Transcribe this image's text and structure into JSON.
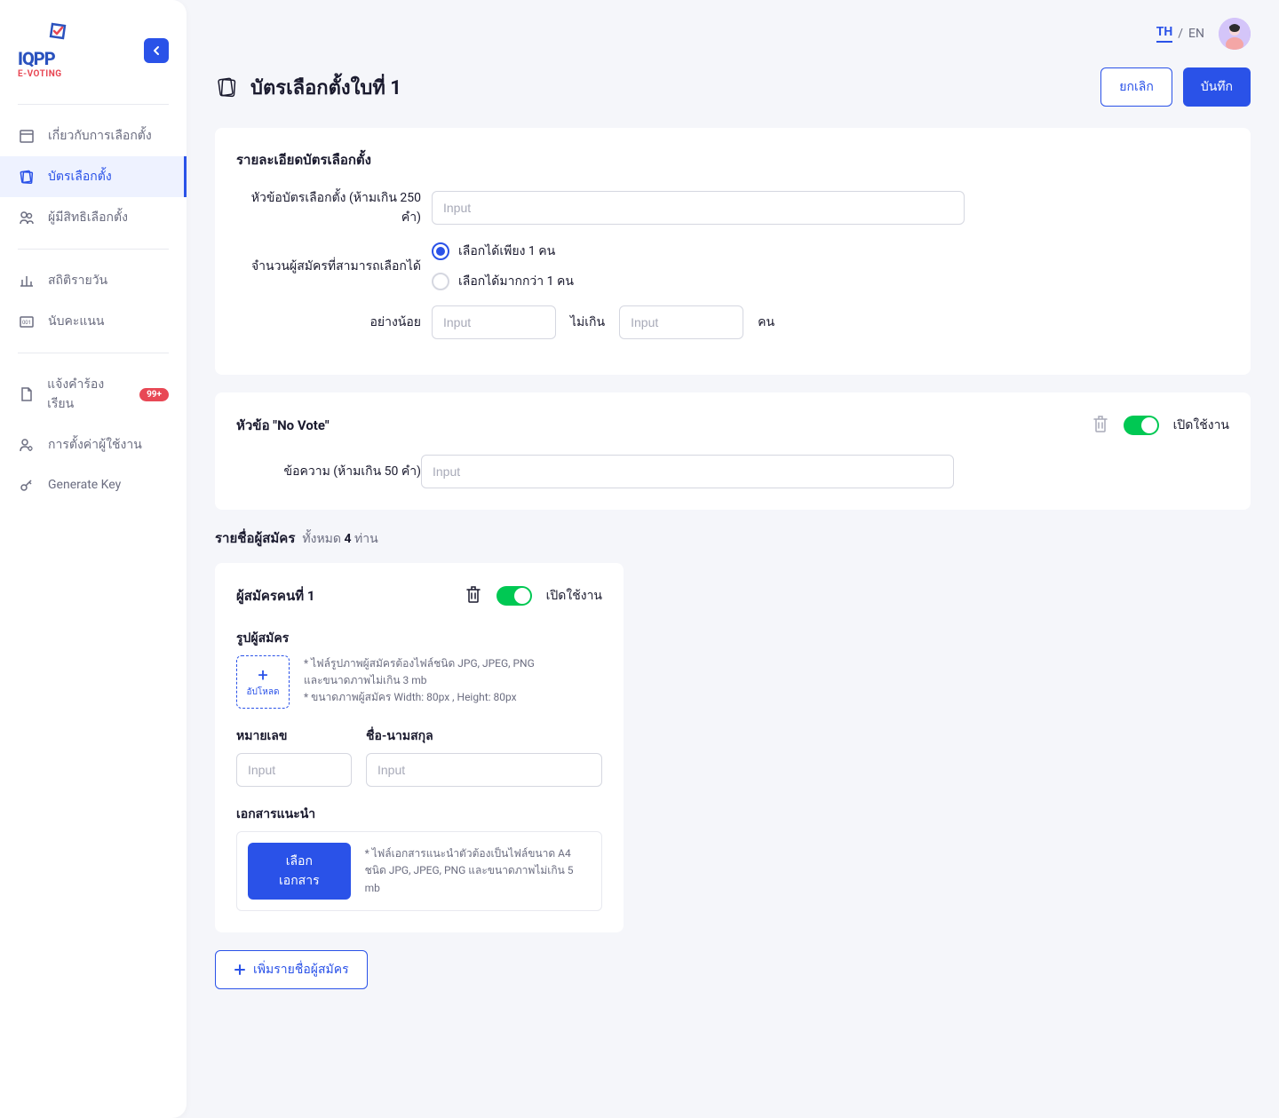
{
  "lang": {
    "th": "TH",
    "en": "EN",
    "sep": "/"
  },
  "logo": {
    "top": "IQPP",
    "sub": "E-VOTING"
  },
  "nav": {
    "about": "เกี่ยวกับการเลือกตั้ง",
    "ballot": "บัตรเลือกตั้ง",
    "voters": "ผู้มีสิทธิเลือกตั้ง",
    "daily": "สถิติรายวัน",
    "count": "นับคะแนน",
    "complaint": "แจ้งคำร้องเรียน",
    "complaint_badge": "99+",
    "settings": "การตั้งค่าผู้ใช้งาน",
    "genkey": "Generate Key"
  },
  "page": {
    "title": "บัตรเลือกตั้งใบที่ 1",
    "cancel": "ยกเลิก",
    "save": "บันทึก"
  },
  "details": {
    "section": "รายละเอียดบัตรเลือกตั้ง",
    "title_label": "หัวข้อบัตรเลือกตั้ง (ห้ามเกิน 250 คำ)",
    "title_placeholder": "Input",
    "count_label": "จำนวนผู้สมัครที่สามารถเลือกได้",
    "radio_one": "เลือกได้เพียง 1 คน",
    "radio_many": "เลือกได้มากกว่า 1 คน",
    "at_least": "อย่างน้อย",
    "at_most": "ไม่เกิน",
    "unit": "คน",
    "min_placeholder": "Input",
    "max_placeholder": "Input"
  },
  "novote": {
    "section": "หัวข้อ \"No Vote\"",
    "enable": "เปิดใช้งาน",
    "msg_label": "ข้อความ (ห้ามเกิน 50 คำ)",
    "msg_placeholder": "Input"
  },
  "candidates": {
    "section": "รายชื่อผู้สมัคร",
    "total_label": "ทั้งหมด",
    "total_count": "4",
    "total_unit": "ท่าน",
    "item_title": "ผู้สมัครคนที่ 1",
    "enable": "เปิดใช้งาน",
    "photo_label": "รูปผู้สมัคร",
    "upload": "อัปโหลด",
    "hint1": "* ไฟล์รูปภาพผู้สมัครต้องไฟล์ชนิด JPG, JPEG, PNG",
    "hint2": "และขนาดภาพไม่เกิน 3 mb",
    "hint3": "* ขนาดภาพผู้สมัคร Width: 80px , Height: 80px",
    "number_label": "หมายเลข",
    "number_placeholder": "Input",
    "name_label": "ชื่อ-นามสกุล",
    "name_placeholder": "Input",
    "doc_label": "เอกสารแนะนำ",
    "doc_btn": "เลือกเอกสาร",
    "doc_hint1": "* ไฟล์เอกสารแนะนำตัวต้องเป็นไฟล์ขนาด A4",
    "doc_hint2": "ชนิด JPG, JPEG, PNG และขนาดภาพไม่เกิน 5 mb",
    "add": "เพิ่มรายชื่อผู้สมัคร"
  }
}
